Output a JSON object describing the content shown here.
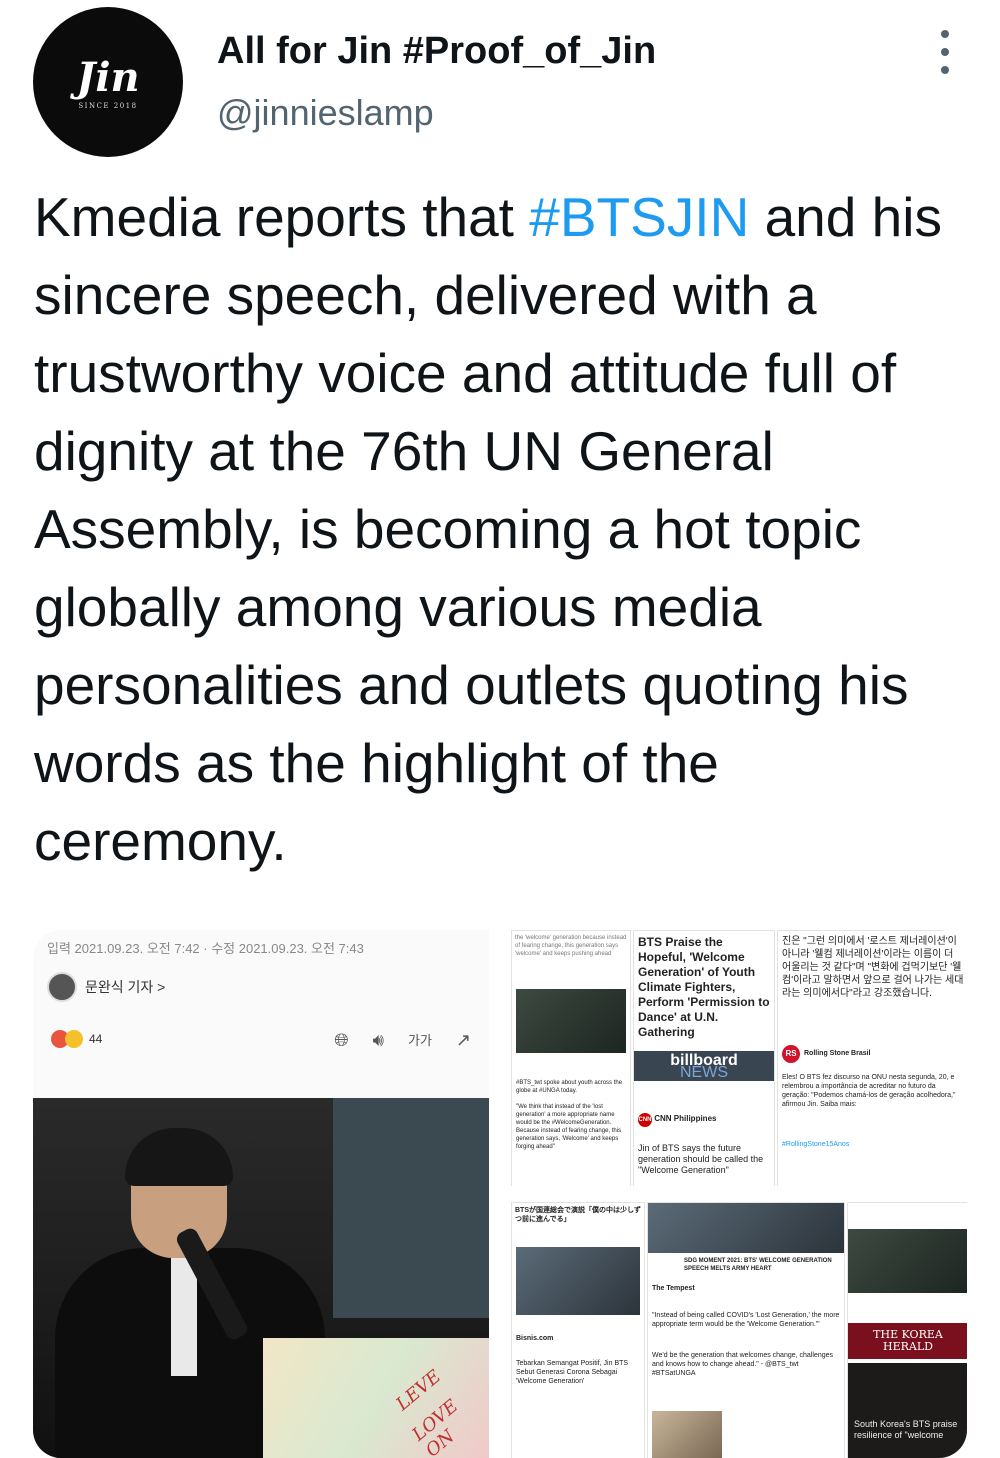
{
  "account": {
    "avatar_logo": "Jin",
    "avatar_since": "SINCE 2018",
    "display_name": "All for Jin #Proof_of_Jin",
    "handle": "@jinnieslamp"
  },
  "tweet": {
    "before": "Kmedia reports that ",
    "hashtag": "#BTSJIN",
    "after": " and his sincere speech, delivered with a trustworthy voice and attitude full of dignity at the 76th UN General Assembly, is becoming a hot topic globally among various media personalities and outlets quoting his words as the highlight of the ceremony.",
    "hashtag_color": "#1d9bf0"
  },
  "media": {
    "article": {
      "meta": "입력 2021.09.23. 오전 7:42 · 수정 2021.09.23. 오전 7:43",
      "reporter": "문완식 기자 >",
      "reaction_count": "44",
      "font_size_label": "가가",
      "sign_text_1": "LEVE",
      "sign_text_2": "LOVE ON"
    },
    "collage_top": {
      "tweet_top": "the 'welcome' generation because instead of fearing change, this generation says 'welcome' and keeps pushing ahead",
      "headline": "BTS Praise the Hopeful, 'Welcome Generation' of Youth Climate Fighters, Perform 'Permission to Dance' at U.N. Gathering",
      "korean_quote": "진은 \"그런 의미에서 '로스트 제너레이션'이 아니라 '웰컴 제너레이션'이라는 이름이 더 어울리는 것 같다\"며 \"변화에 겁먹기보단 '웰컴'이라고 말하면서 앞으로 걸어 나가는 세대라는 의미에서다\"라고 강조했습니다.",
      "billboard": "billboard",
      "billboard_news": "NEWS",
      "cnn_name": "CNN Philippines",
      "cnn_text": "Jin of BTS says the future generation should be called the \"Welcome Generation\"",
      "rs_name": "Rolling Stone Brasil",
      "rs_text": "Eles! O BTS fez discurso na ONU nesta segunda, 20, e relembrou a importância de acreditar no futuro da geração: \"Podemos chamá-los de geração acolhedora,\" afirmou Jin. Saiba mais:",
      "rs_tag": "#RollingStone15Anos",
      "bts_tweet": "#BTS_twt spoke about youth across the globe at #UNGA today.",
      "welcome_quote": "\"We think that instead of the 'lost generation' a more appropriate name would be the #WelcomeGeneration. Because instead of fearing change, this generation says, 'Welcome' and keeps forging ahead\""
    },
    "collage_bottom": {
      "jp_headline": "BTSが国連総会で演説「僕の中は少しずつ前に進んでる」",
      "sdg": "SDG MOMENT 2021: BTS' WELCOME GENERATION SPEECH MELTS ARMY HEART",
      "tempest_name": "The Tempest",
      "tempest_text": "\"Instead of being called COVID's 'Lost Generation,' the more appropriate term would be the 'Welcome Generation.'\"",
      "welcome_line": "We'd be the generation that welcomes change, challenges and knows how to change ahead.\" - @BTS_twt #BTSatUNGA",
      "indo_name": "Bisnis.com",
      "indo_text": "Tebarkan Semangat Positif, Jin BTS Sebut Generasi Corona Sebagai 'Welcome Generation'",
      "herald": "THE KOREA HERALD",
      "herald_caption": "South Korea's BTS praise resilience of \"welcome"
    }
  }
}
